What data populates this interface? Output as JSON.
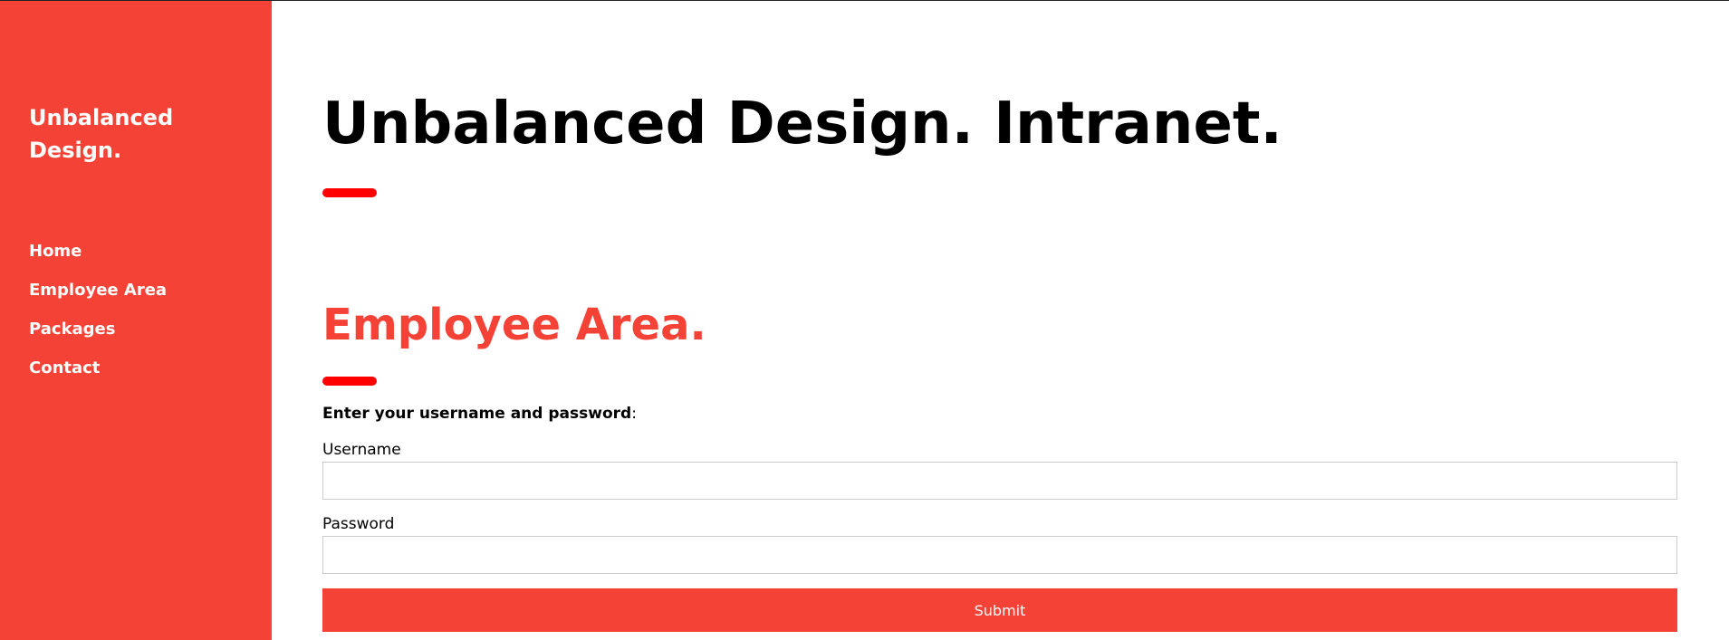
{
  "sidebar": {
    "brand": "Unbalanced Design.",
    "nav": [
      {
        "label": "Home"
      },
      {
        "label": "Employee Area"
      },
      {
        "label": "Packages"
      },
      {
        "label": "Contact"
      }
    ]
  },
  "main": {
    "title": "Unbalanced Design. Intranet.",
    "section_title": "Employee Area.",
    "prompt_bold": "Enter your username and password",
    "prompt_suffix": ":",
    "username_label": "Username",
    "username_value": "",
    "password_label": "Password",
    "password_value": "",
    "submit_label": "Submit"
  },
  "colors": {
    "sidebar_bg": "#f44336",
    "accent_bar": "#ff0000",
    "section_title": "#f44336",
    "button_bg": "#f44336"
  }
}
